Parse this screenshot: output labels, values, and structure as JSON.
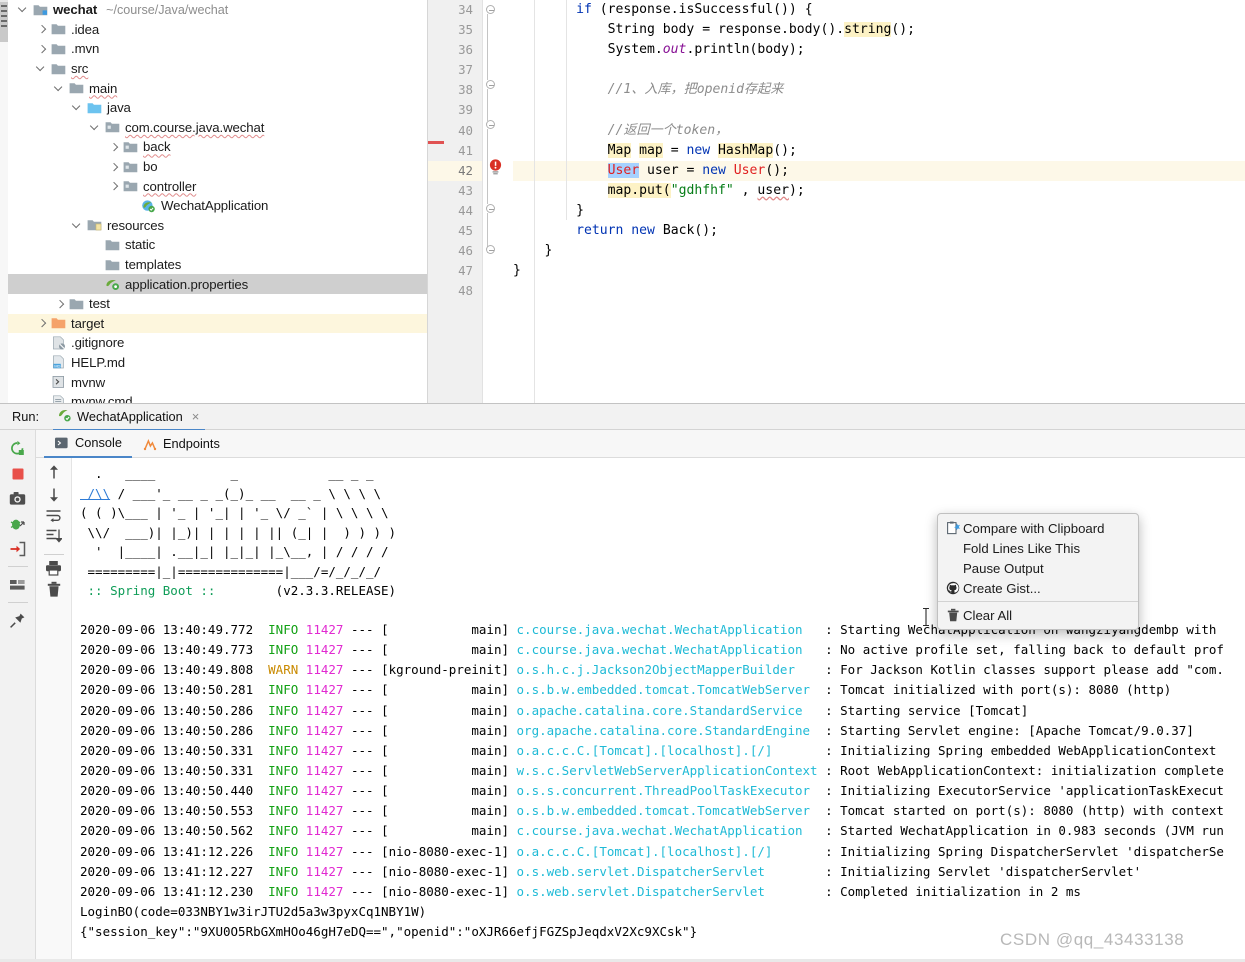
{
  "project_tree": {
    "rows": [
      {
        "indent": 0,
        "arrow": "down",
        "icon": "module-folder",
        "label": "wechat",
        "bold": true,
        "path": "~/course/Java/wechat",
        "state": "normal"
      },
      {
        "indent": 1,
        "arrow": "right",
        "icon": "folder",
        "label": ".idea",
        "state": "normal"
      },
      {
        "indent": 1,
        "arrow": "right",
        "icon": "folder",
        "label": ".mvn",
        "state": "normal"
      },
      {
        "indent": 1,
        "arrow": "down",
        "icon": "folder",
        "label": "src",
        "wavy": true,
        "state": "normal"
      },
      {
        "indent": 2,
        "arrow": "down",
        "icon": "folder",
        "label": "main",
        "wavy": true,
        "state": "normal"
      },
      {
        "indent": 3,
        "arrow": "down",
        "icon": "folder-blue",
        "label": "java",
        "state": "normal"
      },
      {
        "indent": 4,
        "arrow": "down",
        "icon": "package",
        "label": "com.course.java.wechat",
        "wavy": true,
        "state": "normal"
      },
      {
        "indent": 5,
        "arrow": "right",
        "icon": "package",
        "label": "back",
        "wavy": true,
        "state": "normal"
      },
      {
        "indent": 5,
        "arrow": "right",
        "icon": "package",
        "label": "bo",
        "state": "normal"
      },
      {
        "indent": 5,
        "arrow": "right",
        "icon": "package",
        "label": "controller",
        "wavy": true,
        "state": "normal"
      },
      {
        "indent": 6,
        "arrow": "none",
        "icon": "spring-class",
        "label": "WechatApplication",
        "state": "normal"
      },
      {
        "indent": 3,
        "arrow": "down",
        "icon": "resources-folder",
        "label": "resources",
        "state": "normal"
      },
      {
        "indent": 4,
        "arrow": "none",
        "icon": "folder",
        "label": "static",
        "state": "normal"
      },
      {
        "indent": 4,
        "arrow": "none",
        "icon": "folder",
        "label": "templates",
        "state": "normal"
      },
      {
        "indent": 4,
        "arrow": "none",
        "icon": "spring-props",
        "label": "application.properties",
        "state": "selected"
      },
      {
        "indent": 2,
        "arrow": "right",
        "icon": "folder",
        "label": "test",
        "state": "normal"
      },
      {
        "indent": 1,
        "arrow": "right",
        "icon": "folder-orange",
        "label": "target",
        "state": "highlight"
      },
      {
        "indent": 1,
        "arrow": "none",
        "icon": "gitignore",
        "label": ".gitignore",
        "state": "normal"
      },
      {
        "indent": 1,
        "arrow": "none",
        "icon": "markdown",
        "label": "HELP.md",
        "state": "normal"
      },
      {
        "indent": 1,
        "arrow": "none",
        "icon": "script",
        "label": "mvnw",
        "state": "normal"
      },
      {
        "indent": 1,
        "arrow": "none",
        "icon": "cmd",
        "label": "mvnw.cmd",
        "state": "normal"
      }
    ]
  },
  "editor": {
    "line_numbers": [
      "34",
      "35",
      "36",
      "37",
      "38",
      "39",
      "40",
      "41",
      "42",
      "43",
      "44",
      "45",
      "46",
      "47",
      "48"
    ],
    "current_line": "42",
    "lines": [
      {
        "n": "34",
        "tokens": [
          {
            "t": "        ",
            "c": "plain"
          },
          {
            "t": "if",
            "c": "kw"
          },
          {
            "t": " (response.isSuccessful()) {",
            "c": "plain"
          }
        ]
      },
      {
        "n": "35",
        "tokens": [
          {
            "t": "            String body = response.body().",
            "c": "plain"
          },
          {
            "t": "string",
            "c": "hlw"
          },
          {
            "t": "();",
            "c": "plain"
          }
        ]
      },
      {
        "n": "36",
        "tokens": [
          {
            "t": "            System.",
            "c": "plain"
          },
          {
            "t": "out",
            "c": "fld"
          },
          {
            "t": ".println(body);",
            "c": "plain"
          }
        ]
      },
      {
        "n": "37",
        "tokens": []
      },
      {
        "n": "38",
        "tokens": [
          {
            "t": "            //1、入库，把openid存起来",
            "c": "cmt"
          }
        ]
      },
      {
        "n": "39",
        "tokens": []
      },
      {
        "n": "40",
        "tokens": [
          {
            "t": "            //返回一个token，",
            "c": "cmt"
          }
        ]
      },
      {
        "n": "41",
        "tokens": [
          {
            "t": "            ",
            "c": "plain"
          },
          {
            "t": "Map",
            "c": "hlw"
          },
          {
            "t": " ",
            "c": "plain"
          },
          {
            "t": "map",
            "c": "hlw"
          },
          {
            "t": " = ",
            "c": "plain"
          },
          {
            "t": "new",
            "c": "kw"
          },
          {
            "t": " ",
            "c": "plain"
          },
          {
            "t": "HashMap",
            "c": "hlw"
          },
          {
            "t": "();",
            "c": "plain"
          }
        ]
      },
      {
        "n": "42",
        "tokens": [
          {
            "t": "            ",
            "c": "plain"
          },
          {
            "t": "User",
            "c": "selw"
          },
          {
            "t": " user = ",
            "c": "plain"
          },
          {
            "t": "new",
            "c": "kw"
          },
          {
            "t": " ",
            "c": "plain"
          },
          {
            "t": "User",
            "c": "err"
          },
          {
            "t": "();",
            "c": "plain"
          }
        ]
      },
      {
        "n": "43",
        "tokens": [
          {
            "t": "            ",
            "c": "plain"
          },
          {
            "t": "map.put(",
            "c": "hlw"
          },
          {
            "t": "\"gdhfhf\"",
            "c": "str"
          },
          {
            "t": " , ",
            "c": "plain"
          },
          {
            "t": "user",
            "c": "undr"
          },
          {
            "t": ");",
            "c": "plain"
          }
        ]
      },
      {
        "n": "44",
        "tokens": [
          {
            "t": "        }",
            "c": "plain"
          }
        ]
      },
      {
        "n": "45",
        "tokens": [
          {
            "t": "        ",
            "c": "plain"
          },
          {
            "t": "return",
            "c": "kw"
          },
          {
            "t": " ",
            "c": "plain"
          },
          {
            "t": "new",
            "c": "kw"
          },
          {
            "t": " Back();",
            "c": "plain"
          }
        ]
      },
      {
        "n": "46",
        "tokens": [
          {
            "t": "    }",
            "c": "plain"
          }
        ]
      },
      {
        "n": "47",
        "tokens": [
          {
            "t": "}",
            "c": "plain"
          }
        ]
      },
      {
        "n": "48",
        "tokens": []
      }
    ]
  },
  "run_panel": {
    "run_label": "Run:",
    "config_name": "WechatApplication",
    "close_label": "×",
    "tabs": [
      {
        "label": "Console",
        "icon": "console-icon",
        "active": true
      },
      {
        "label": "Endpoints",
        "icon": "endpoints-icon",
        "active": false
      }
    ],
    "toolbar_left": [
      "rerun-icon",
      "stop-icon",
      "camera-icon",
      "debug-icon",
      "export-icon",
      "layout-icon",
      "pin-icon"
    ],
    "toolbar_inner": [
      "scroll-up-icon",
      "scroll-down-icon",
      "soft-wrap-icon",
      "scroll-to-end-icon",
      "print-icon",
      "trash-icon"
    ]
  },
  "console": {
    "banner_lines": [
      "  .   ____          _            __ _ _",
      " /\\\\ / ___'_ __ _ _(_)_ __  __ _ \\ \\ \\ \\",
      "( ( )\\___ | '_ | '_| | '_ \\/ _` | \\ \\ \\ \\",
      " \\\\/  ___)| |_)| | | | | || (_| |  ) ) ) )",
      "  '  |____| .__|_| |_|_| |_\\__, | / / / /",
      " =========|_|==============|___/=/_/_/_/"
    ],
    "spring_line": " :: Spring Boot ::        (v2.3.3.RELEASE)",
    "log_lines": [
      {
        "ts": "2020-09-06 13:40:49.772",
        "level": "INFO",
        "pid": "11427",
        "thread": "main",
        "logger": "c.course.java.wechat.WechatApplication",
        "message": "Starting WechatApplication on wangziyangdembp with"
      },
      {
        "ts": "2020-09-06 13:40:49.773",
        "level": "INFO",
        "pid": "11427",
        "thread": "main",
        "logger": "c.course.java.wechat.WechatApplication",
        "message": "No active profile set, falling back to default prof"
      },
      {
        "ts": "2020-09-06 13:40:49.808",
        "level": "WARN",
        "pid": "11427",
        "thread": "kground-preinit",
        "logger": "o.s.h.c.j.Jackson2ObjectMapperBuilder",
        "message": "For Jackson Kotlin classes support please add \"com."
      },
      {
        "ts": "2020-09-06 13:40:50.281",
        "level": "INFO",
        "pid": "11427",
        "thread": "main",
        "logger": "o.s.b.w.embedded.tomcat.TomcatWebServer",
        "message": "Tomcat initialized with port(s): 8080 (http)"
      },
      {
        "ts": "2020-09-06 13:40:50.286",
        "level": "INFO",
        "pid": "11427",
        "thread": "main",
        "logger": "o.apache.catalina.core.StandardService",
        "message": "Starting service [Tomcat]"
      },
      {
        "ts": "2020-09-06 13:40:50.286",
        "level": "INFO",
        "pid": "11427",
        "thread": "main",
        "logger": "org.apache.catalina.core.StandardEngine",
        "message": "Starting Servlet engine: [Apache Tomcat/9.0.37]"
      },
      {
        "ts": "2020-09-06 13:40:50.331",
        "level": "INFO",
        "pid": "11427",
        "thread": "main",
        "logger": "o.a.c.c.C.[Tomcat].[localhost].[/]",
        "message": "Initializing Spring embedded WebApplicationContext"
      },
      {
        "ts": "2020-09-06 13:40:50.331",
        "level": "INFO",
        "pid": "11427",
        "thread": "main",
        "logger": "w.s.c.ServletWebServerApplicationContext",
        "message": "Root WebApplicationContext: initialization complete"
      },
      {
        "ts": "2020-09-06 13:40:50.440",
        "level": "INFO",
        "pid": "11427",
        "thread": "main",
        "logger": "o.s.s.concurrent.ThreadPoolTaskExecutor",
        "message": "Initializing ExecutorService 'applicationTaskExecut"
      },
      {
        "ts": "2020-09-06 13:40:50.553",
        "level": "INFO",
        "pid": "11427",
        "thread": "main",
        "logger": "o.s.b.w.embedded.tomcat.TomcatWebServer",
        "message": "Tomcat started on port(s): 8080 (http) with context"
      },
      {
        "ts": "2020-09-06 13:40:50.562",
        "level": "INFO",
        "pid": "11427",
        "thread": "main",
        "logger": "c.course.java.wechat.WechatApplication",
        "message": "Started WechatApplication in 0.983 seconds (JVM run"
      },
      {
        "ts": "2020-09-06 13:41:12.226",
        "level": "INFO",
        "pid": "11427",
        "thread": "nio-8080-exec-1",
        "logger": "o.a.c.c.C.[Tomcat].[localhost].[/]",
        "message": "Initializing Spring DispatcherServlet 'dispatcherSe"
      },
      {
        "ts": "2020-09-06 13:41:12.227",
        "level": "INFO",
        "pid": "11427",
        "thread": "nio-8080-exec-1",
        "logger": "o.s.web.servlet.DispatcherServlet",
        "message": "Initializing Servlet 'dispatcherServlet'"
      },
      {
        "ts": "2020-09-06 13:41:12.230",
        "level": "INFO",
        "pid": "11427",
        "thread": "nio-8080-exec-1",
        "logger": "o.s.web.servlet.DispatcherServlet",
        "message": "Completed initialization in 2 ms"
      }
    ],
    "output_lines": [
      "LoginBO(code=033NBY1w3irJTU2d5a3w3pyxCq1NBY1W)",
      "{\"session_key\":\"9XU0O5RbGXmHOo46gH7eDQ==\",\"openid\":\"oXJR66efjFGZSpJeqdxV2Xc9XCsk\"}"
    ]
  },
  "context_menu": {
    "items": [
      {
        "label": "Compare with Clipboard",
        "icon": "compare-clipboard-icon",
        "separator_after": false
      },
      {
        "label": "Fold Lines Like This",
        "icon": "none",
        "separator_after": false
      },
      {
        "label": "Pause Output",
        "icon": "none",
        "separator_after": false
      },
      {
        "label": "Create Gist...",
        "icon": "github-icon",
        "separator_after": true
      },
      {
        "label": "Clear All",
        "icon": "trash-icon",
        "separator_after": false
      }
    ]
  },
  "watermark": {
    "text": "CSDN @qq_43433138"
  },
  "colors": {
    "accent_blue": "#4a86c8",
    "logger_cyan": "#1fbad6",
    "info_green": "#12a014",
    "warn_amber": "#c98a00",
    "pid_magenta": "#e12ad1",
    "selection": "#cfcfcf",
    "highlight_row": "#fdf6dd",
    "spring_green": "#0f9d58"
  }
}
